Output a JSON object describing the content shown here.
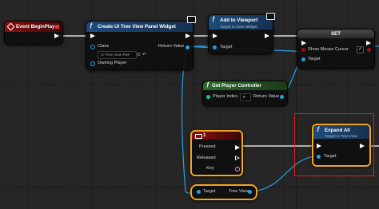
{
  "nodes": {
    "event_begin_play": {
      "title": "Event BeginPlay"
    },
    "create_widget": {
      "title": "Create UI Tree View Panel Widget",
      "class_label": "Class",
      "class_value": "UI Tree View Pa▾",
      "owning_player_label": "Owning Player",
      "return_value_label": "Return Value"
    },
    "add_to_viewport": {
      "title": "Add to Viewport",
      "subtitle": "Target is User Widget",
      "target_label": "Target"
    },
    "set_node": {
      "title": "SET",
      "show_mouse_cursor_label": "Show Mouse Cursor",
      "show_mouse_cursor_checked": "✓",
      "target_label": "Target"
    },
    "get_player_controller": {
      "title": "Get Player Controller",
      "player_index_label": "Player Index",
      "player_index_value": "0",
      "return_value_label": "Return Value"
    },
    "key_event": {
      "title": "1",
      "pressed_label": "Pressed",
      "released_label": "Released",
      "key_label": "Key"
    },
    "expand_all": {
      "title": "Expand All",
      "subtitle": "Target is Tree View",
      "target_label": "Target"
    },
    "tree_view_getter": {
      "target_label": "Target",
      "tree_view_label": "Tree View"
    }
  },
  "colors": {
    "exec_wire": "#ffffff",
    "object_wire": "#28a0e0",
    "selection": "#f0a520",
    "highlight": "#e02020"
  }
}
